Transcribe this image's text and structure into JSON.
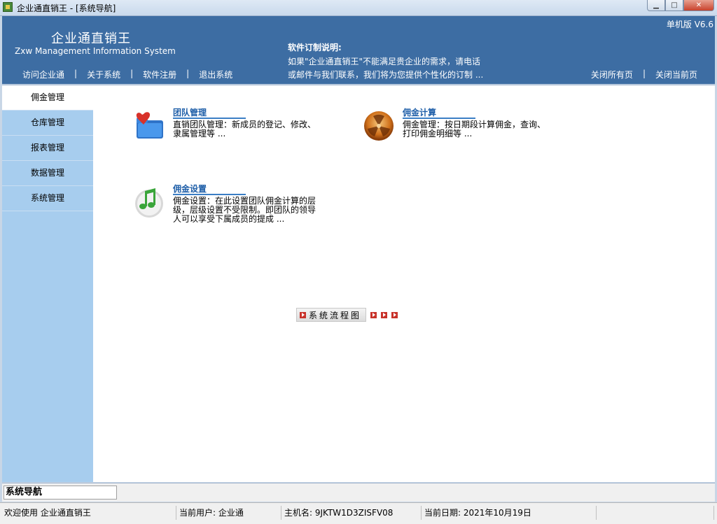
{
  "window": {
    "title": "企业通直销王 - [系统导航]",
    "buttons": {
      "minimize": "▁",
      "maximize": "□",
      "close": "✕"
    }
  },
  "header": {
    "brand": "企业通直销王",
    "brand_en": "Zxw Management Information System",
    "version": "单机版 V6.6",
    "notice_title": "软件订制说明:",
    "notice_line1": "如果\"企业通直销王\"不能满足贵企业的需求，请电话",
    "notice_line2": "或邮件与我们联系，我们将为您提供个性化的订制 ...",
    "nav": [
      "访问企业通",
      "关于系统",
      "软件注册",
      "退出系统"
    ],
    "nav_right": [
      "关闭所有页",
      "关闭当前页"
    ],
    "separator": "|"
  },
  "sidebar": {
    "items": [
      "佣金管理",
      "仓库管理",
      "报表管理",
      "数据管理",
      "系统管理"
    ],
    "active_index": 0
  },
  "features": [
    {
      "title": "团队管理",
      "desc": "直销团队管理：新成员的登记、修改、隶属管理等 ...",
      "icon": "team-folder-icon"
    },
    {
      "title": "佣金计算",
      "desc": "佣金管理：按日期段计算佣金，查询、打印佣金明细等 ...",
      "icon": "commission-orb-icon"
    },
    {
      "title": "佣金设置",
      "desc": "佣金设置：在此设置团队佣金计算的层级，层级设置不受限制。即团队的领导人可以享受下属成员的提成 ...",
      "icon": "music-note-icon"
    }
  ],
  "flow": {
    "label": "系统流程图"
  },
  "bottom": {
    "nav_field": "系统导航",
    "status": [
      "欢迎使用 企业通直销王",
      "当前用户: 企业通",
      "主机名: 9JKTW1D3ZISFV08",
      "当前日期: 2021年10月19日"
    ]
  },
  "colors": {
    "header_bg": "#3d6da3",
    "sidebar_bg": "#a7cdee",
    "link": "#1e5ea8"
  }
}
